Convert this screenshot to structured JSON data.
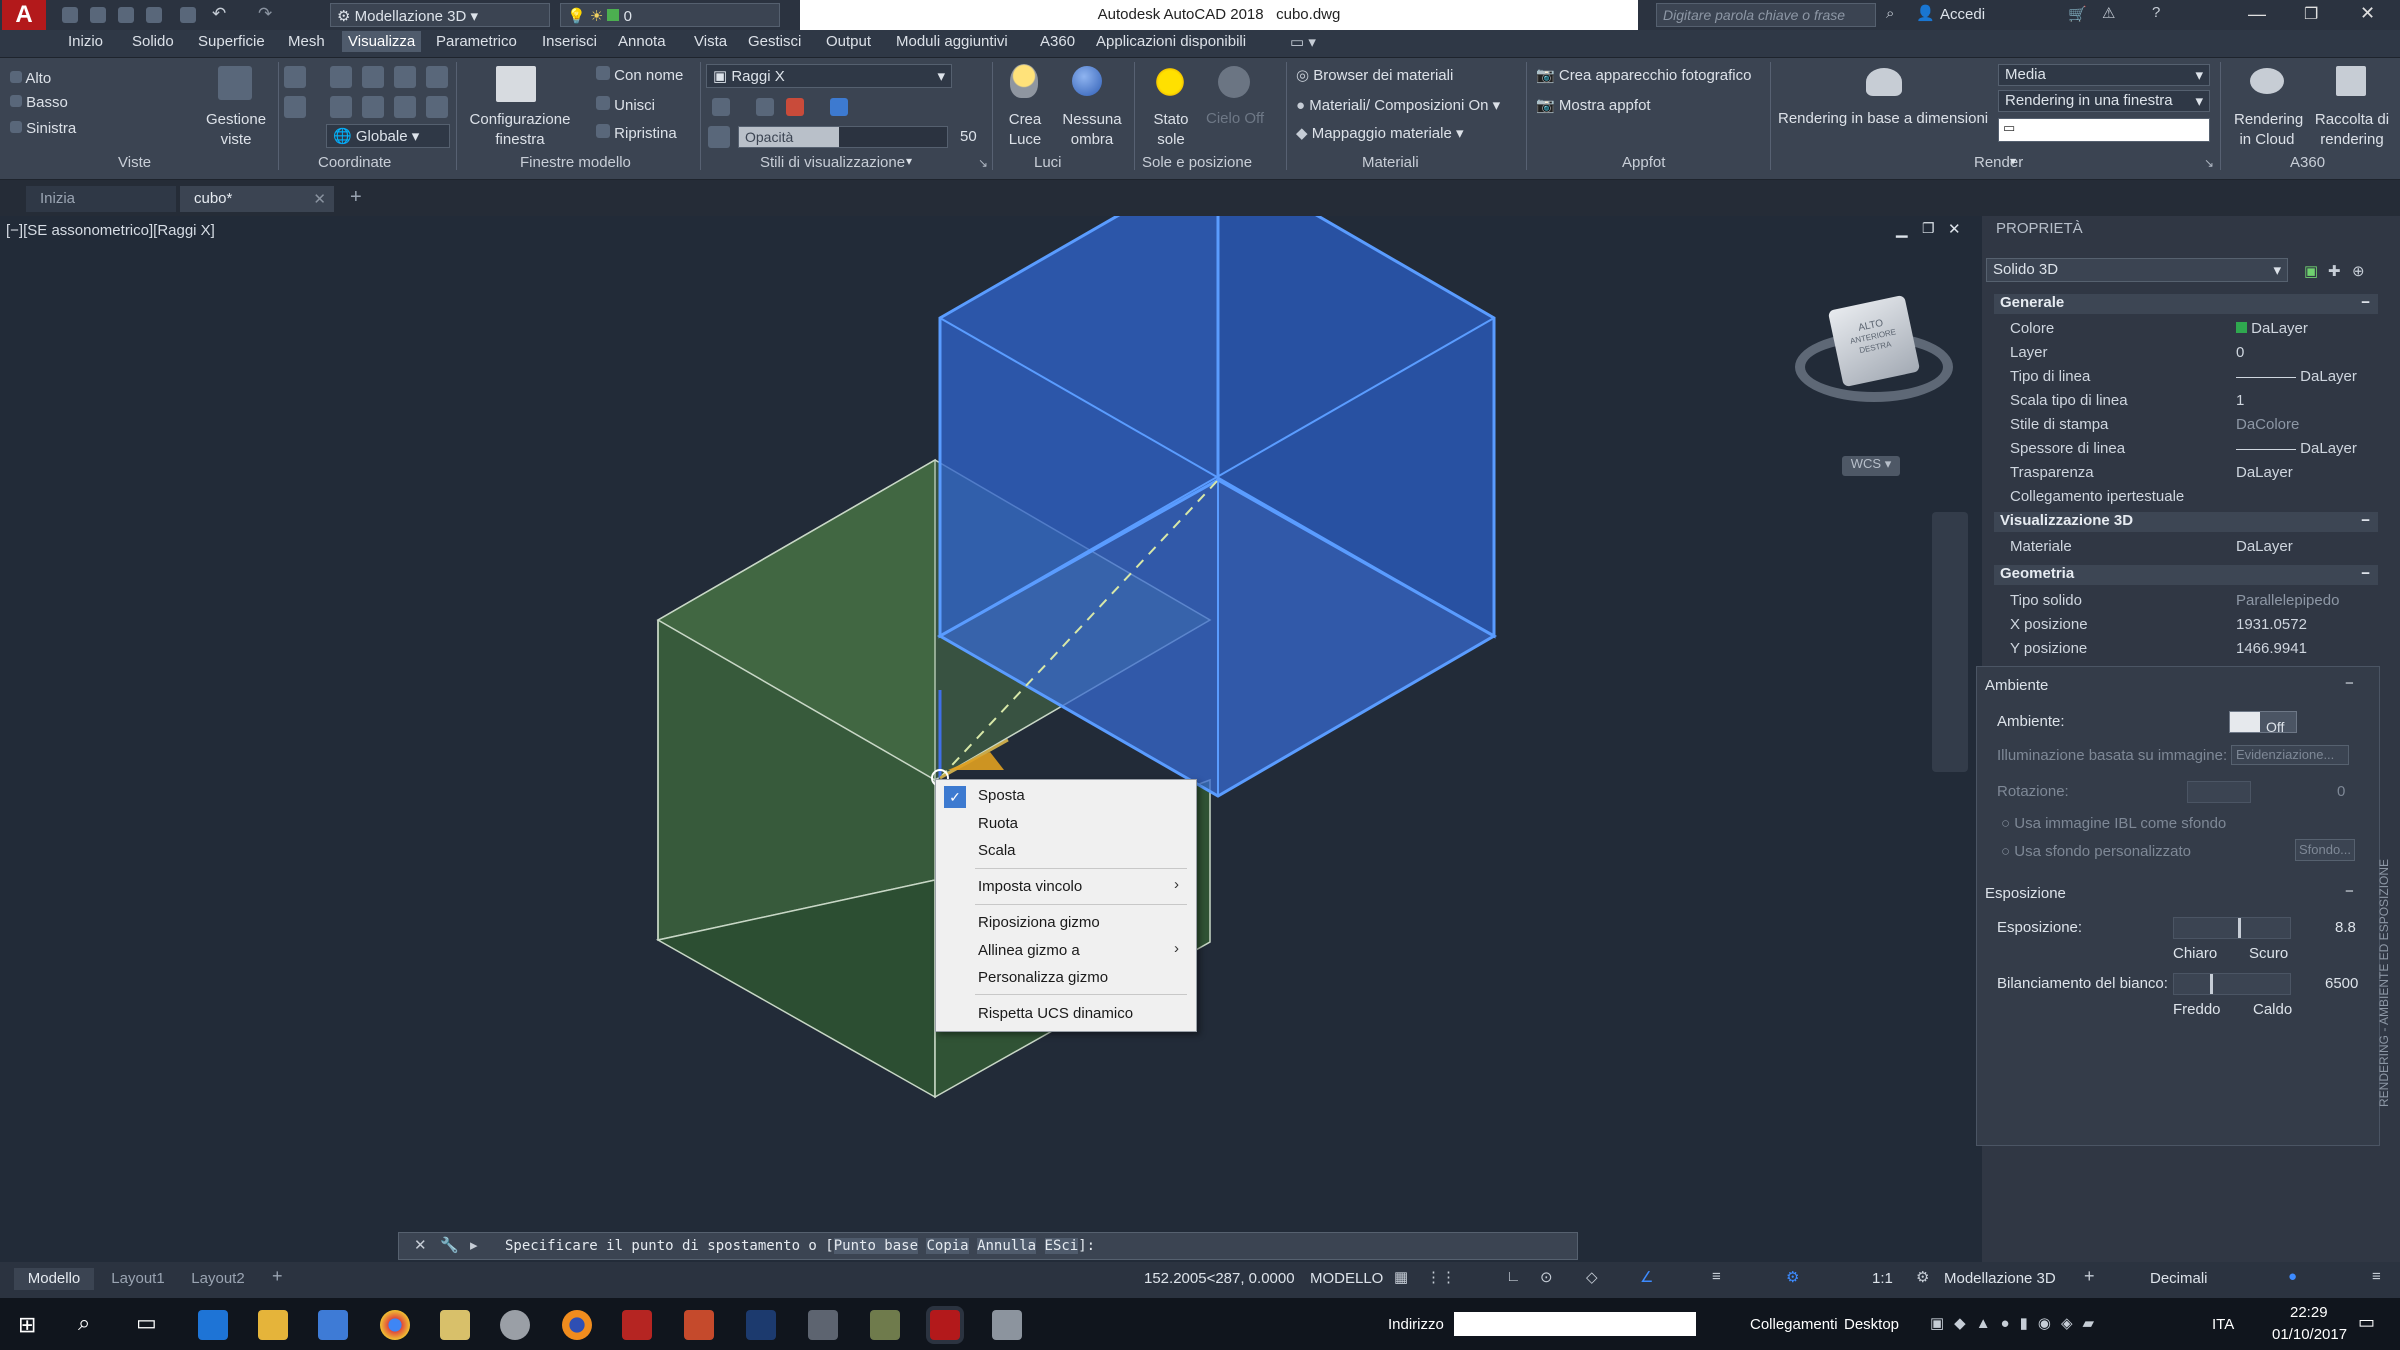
{
  "title_bar": {
    "workspace": "Modellazione 3D",
    "layer_value": "0",
    "app_title": "Autodesk AutoCAD 2018",
    "file_name": "cubo.dwg",
    "search_placeholder": "Digitare parola chiave o frase",
    "signin": "Accedi"
  },
  "menu_tabs": [
    "Inizio",
    "Solido",
    "Superficie",
    "Mesh",
    "Visualizza",
    "Parametrico",
    "Inserisci",
    "Annota",
    "Vista",
    "Gestisci",
    "Output",
    "Moduli aggiuntivi",
    "A360",
    "Applicazioni disponibili"
  ],
  "active_tab": "Visualizza",
  "ribbon": {
    "views": [
      "Alto",
      "Basso",
      "Sinistra"
    ],
    "gestione_viste": "Gestione viste",
    "coord_globale": "Globale",
    "config_finestra": "Configurazione finestra",
    "con_nome": "Con nome",
    "unisci": "Unisci",
    "ripristina": "Ripristina",
    "visual_style": "Raggi X",
    "opacity_label": "Opacità",
    "opacity_value": "50",
    "crea_luce": "Crea Luce",
    "nessuna_ombra": "Nessuna ombra",
    "stato_sole": "Stato sole",
    "cielo_off": "Cielo Off",
    "browser_materiali": "Browser dei materiali",
    "materiali_comp": "Materiali/ Composizioni On",
    "mappaggio": "Mappaggio materiale",
    "crea_apparecchio": "Crea apparecchio fotografico",
    "mostra_appfot": "Mostra appfot",
    "rendering_dim": "Rendering in base a dimensioni",
    "render_preset": "Media",
    "render_target": "Rendering in una finestra",
    "rendering_cloud": "Rendering in Cloud",
    "raccolta_rendering": "Raccolta di rendering",
    "groups": [
      "Viste",
      "Coordinate",
      "Finestre modello",
      "Stili di visualizzazione",
      "Luci",
      "Sole e posizione",
      "Materiali",
      "Appfot",
      "Render",
      "A360"
    ]
  },
  "doc_tabs": [
    "Inizia",
    "cubo*"
  ],
  "viewport_label": "[−][SE assonometrico][Raggi X]",
  "viewcube": {
    "top": "ALTO",
    "front": "ANTERIORE",
    "right": "DESTRA",
    "wcs": "WCS"
  },
  "context_menu": [
    "Sposta",
    "Ruota",
    "Scala",
    "Imposta vincolo",
    "Riposiziona gizmo",
    "Allinea gizmo a",
    "Personalizza gizmo",
    "Rispetta UCS dinamico"
  ],
  "command_line": {
    "text": "Specificare il punto di spostamento o",
    "opt_base": "Punto base",
    "opt_copia": "Copia",
    "opt_annulla": "Annulla",
    "opt_esci": "ESci",
    "suffix": "]:"
  },
  "properties": {
    "title": "PROPRIETÀ",
    "object": "Solido 3D",
    "generale": "Generale",
    "rows": [
      [
        "Colore",
        "DaLayer"
      ],
      [
        "Layer",
        "0"
      ],
      [
        "Tipo di linea",
        "DaLayer"
      ],
      [
        "Scala tipo di linea",
        "1"
      ],
      [
        "Stile di stampa",
        "DaColore"
      ],
      [
        "Spessore di linea",
        "DaLayer"
      ],
      [
        "Trasparenza",
        "DaLayer"
      ],
      [
        "Collegamento ipertestuale",
        ""
      ]
    ],
    "visual3d": "Visualizzazione 3D",
    "materiale": "Materiale",
    "materiale_val": "DaLayer",
    "geometria": "Geometria",
    "tipo_solido": "Tipo solido",
    "tipo_solido_val": "Parallelepipedo",
    "xpos": "X posizione",
    "xpos_val": "1931.0572",
    "ypos": "Y posizione",
    "ypos_val": "1466.9941"
  },
  "env_panel": {
    "title": "Ambiente",
    "ambiente": "Ambiente:",
    "off": "Off",
    "ibl": "Illuminazione basata su immagine:",
    "ibl_val": "Evidenziazione...",
    "rotazione": "Rotazione:",
    "rot_val": "0",
    "usa_ibl": "Usa immagine IBL come sfondo",
    "usa_sfondo": "Usa sfondo personalizzato",
    "sfondo": "Sfondo...",
    "esposizione_title": "Esposizione",
    "esposizione": "Esposizione:",
    "esp_val": "8.8",
    "chiaro": "Chiaro",
    "scuro": "Scuro",
    "bilanciamento": "Bilanciamento del bianco:",
    "bil_val": "6500",
    "freddo": "Freddo",
    "caldo": "Caldo",
    "vertical": "RENDERING - AMBIENTE ED ESPOSIZIONE"
  },
  "status": {
    "layouts": [
      "Modello",
      "Layout1",
      "Layout2"
    ],
    "coords": "152.2005<287, 0.0000",
    "mode": "MODELLO",
    "scale": "1:1",
    "workspace": "Modellazione 3D",
    "units": "Decimali"
  },
  "taskbar": {
    "address_label": "Indirizzo",
    "links": "Collegamenti",
    "desktop": "Desktop",
    "lang": "ITA",
    "time": "22:29",
    "date": "01/10/2017"
  },
  "colors": {
    "blue_cube": "#2f6bd8",
    "green_cube": "#3e6b3a",
    "accent": "#c0201c"
  }
}
